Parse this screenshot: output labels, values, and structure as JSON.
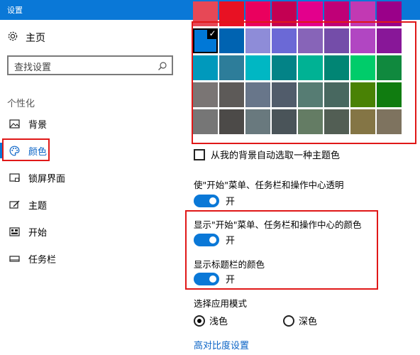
{
  "window": {
    "title": "设置"
  },
  "sidebar": {
    "home_label": "主页",
    "search_placeholder": "查找设置",
    "section_label": "个性化",
    "items": [
      {
        "label": "背景",
        "icon": "picture-icon"
      },
      {
        "label": "颜色",
        "icon": "palette-icon",
        "active": true
      },
      {
        "label": "锁屏界面",
        "icon": "lock-screen-icon"
      },
      {
        "label": "主题",
        "icon": "theme-brush-icon"
      },
      {
        "label": "开始",
        "icon": "start-grid-icon"
      },
      {
        "label": "任务栏",
        "icon": "taskbar-icon"
      }
    ]
  },
  "colors": {
    "accent": "#0a78d7",
    "highlight_box": "#e01818",
    "swatch_rows": [
      [
        "#e74856",
        "#e81123",
        "#ea005e",
        "#c30052",
        "#e3008c",
        "#bf0077",
        "#c239b3",
        "#9a0089"
      ],
      [
        "#0078d7",
        "#0063b1",
        "#8e8cd8",
        "#6b69d6",
        "#8764b8",
        "#744da9",
        "#b146c2",
        "#881798"
      ],
      [
        "#0099bc",
        "#2d7d9a",
        "#00b7c3",
        "#038387",
        "#00b294",
        "#018574",
        "#00cc6a",
        "#10893e"
      ],
      [
        "#7a7574",
        "#5d5a58",
        "#68768a",
        "#515c6b",
        "#567c73",
        "#486860",
        "#498205",
        "#107c10"
      ],
      [
        "#767676",
        "#4c4a48",
        "#69797e",
        "#4a5459",
        "#647c64",
        "#525e54",
        "#847545",
        "#7e735f"
      ]
    ],
    "selected_swatch": "#0078d7"
  },
  "options": {
    "auto_pick_label": "从我的背景自动选取一种主题色",
    "transparency_label": "使\"开始\"菜单、任务栏和操作中心透明",
    "transparency_state": "开",
    "show_color_start_label": "显示\"开始\"菜单、任务栏和操作中心的颜色",
    "show_color_start_state": "开",
    "show_titlebar_label": "显示标题栏的颜色",
    "show_titlebar_state": "开",
    "app_mode_label": "选择应用模式",
    "mode_light": "浅色",
    "mode_dark": "深色",
    "high_contrast_link": "高对比度设置"
  }
}
